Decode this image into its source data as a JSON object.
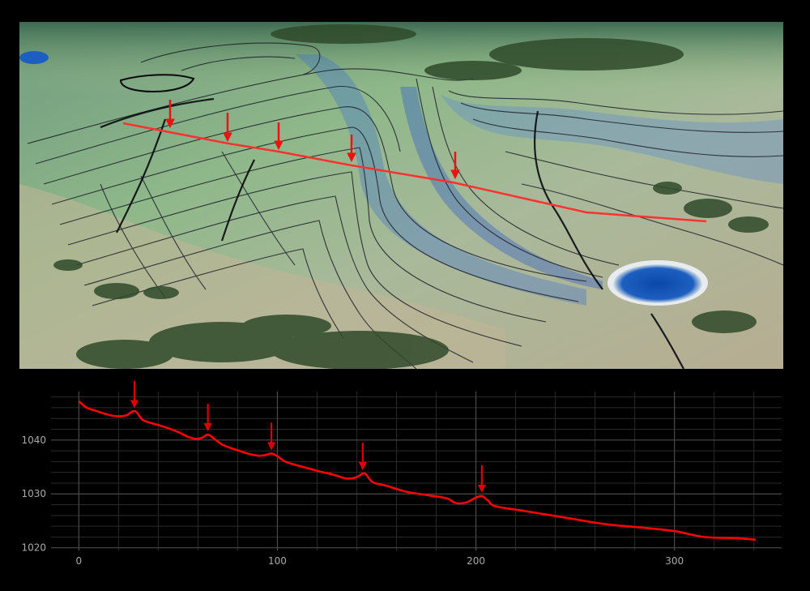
{
  "terrain_view": {
    "description_icon": "terrain-3d-view"
  },
  "chart_data": {
    "type": "line",
    "title": "",
    "xlabel": "",
    "ylabel": "",
    "xlim": [
      -14,
      354
    ],
    "ylim": [
      1019.5,
      1049
    ],
    "x_ticks": [
      0,
      100,
      200,
      300
    ],
    "y_ticks": [
      1020,
      1030,
      1040
    ],
    "grid": true,
    "line_color": "#ff0000",
    "arrow_color": "#dd0000",
    "series": [
      {
        "name": "",
        "x": [
          0,
          4,
          8,
          12,
          16,
          20,
          24,
          27,
          29,
          32,
          36,
          40,
          45,
          50,
          55,
          59,
          62,
          65,
          68,
          72,
          76,
          80,
          85,
          90,
          94,
          97,
          100,
          104,
          110,
          116,
          122,
          128,
          134,
          138,
          141,
          144,
          148,
          155,
          165,
          175,
          185,
          190,
          195,
          200,
          203,
          206,
          210,
          225,
          245,
          265,
          285,
          300,
          315,
          330,
          341
        ],
        "y": [
          1047.2,
          1046.0,
          1045.5,
          1045.0,
          1044.6,
          1044.4,
          1044.6,
          1045.3,
          1045.2,
          1043.8,
          1043.2,
          1042.8,
          1042.2,
          1041.5,
          1040.6,
          1040.2,
          1040.4,
          1041.0,
          1040.3,
          1039.2,
          1038.6,
          1038.1,
          1037.5,
          1037.1,
          1037.2,
          1037.5,
          1037.0,
          1036.0,
          1035.3,
          1034.7,
          1034.1,
          1033.6,
          1032.9,
          1032.9,
          1033.3,
          1033.8,
          1032.2,
          1031.5,
          1030.4,
          1029.8,
          1029.2,
          1028.3,
          1028.4,
          1029.3,
          1029.6,
          1028.8,
          1027.7,
          1026.8,
          1025.6,
          1024.4,
          1023.7,
          1023.1,
          1022.0,
          1021.8,
          1021.5
        ]
      }
    ],
    "annotations": [
      {
        "type": "arrow",
        "x": 28,
        "y": 1045.3
      },
      {
        "type": "arrow",
        "x": 65,
        "y": 1041.0
      },
      {
        "type": "arrow",
        "x": 97,
        "y": 1037.5
      },
      {
        "type": "arrow",
        "x": 143,
        "y": 1033.8
      },
      {
        "type": "arrow",
        "x": 203,
        "y": 1029.6
      }
    ]
  }
}
